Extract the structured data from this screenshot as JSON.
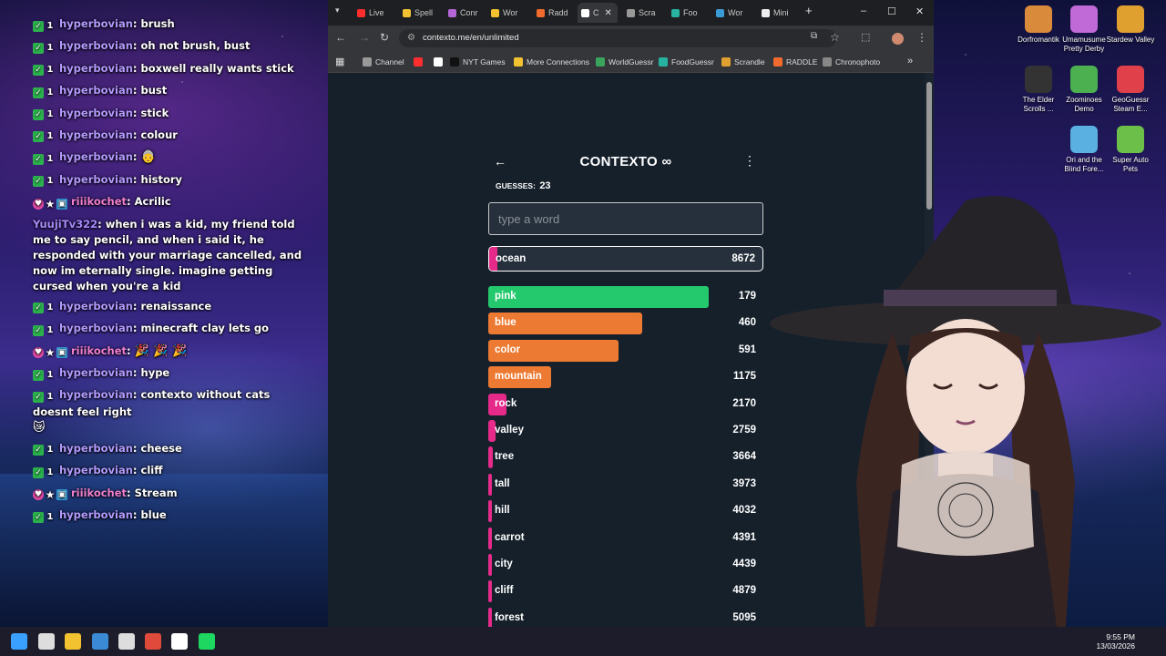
{
  "chat": [
    {
      "badges": [
        "check",
        "1"
      ],
      "user": "hyperbovian",
      "user_style": "normal",
      "text": "brush"
    },
    {
      "badges": [
        "check",
        "1"
      ],
      "user": "hyperbovian",
      "user_style": "normal",
      "text": "oh not brush, bust"
    },
    {
      "badges": [
        "check",
        "1"
      ],
      "user": "hyperbovian",
      "user_style": "normal",
      "text": "boxwell really wants stick"
    },
    {
      "badges": [
        "check",
        "1"
      ],
      "user": "hyperbovian",
      "user_style": "normal",
      "text": "bust"
    },
    {
      "badges": [
        "check",
        "1"
      ],
      "user": "hyperbovian",
      "user_style": "normal",
      "text": "stick"
    },
    {
      "badges": [
        "check",
        "1"
      ],
      "user": "hyperbovian",
      "user_style": "normal",
      "text": "colour"
    },
    {
      "badges": [
        "check",
        "1"
      ],
      "user": "hyperbovian",
      "user_style": "normal",
      "text": "",
      "emote": "👵"
    },
    {
      "badges": [
        "check",
        "1"
      ],
      "user": "hyperbovian",
      "user_style": "normal",
      "text": "history"
    },
    {
      "badges": [
        "heart",
        "star",
        "sub"
      ],
      "user": "riiikochet",
      "user_style": "pink",
      "text": "Acrilic"
    },
    {
      "badges": [],
      "user": "YuujiTv322",
      "user_style": "violet",
      "text": "when i was a kid, my friend told me to say pencil, and when i said it, he responded with your marriage cancelled, and now im eternally single. imagine getting cursed when you're a kid"
    },
    {
      "badges": [
        "check",
        "1"
      ],
      "user": "hyperbovian",
      "user_style": "normal",
      "text": "renaissance"
    },
    {
      "badges": [
        "check",
        "1"
      ],
      "user": "hyperbovian",
      "user_style": "normal",
      "text": "minecraft clay lets go"
    },
    {
      "badges": [
        "heart",
        "star",
        "sub"
      ],
      "user": "riiikochet",
      "user_style": "pink",
      "text": "",
      "emote": "🎉 🎉 🎉"
    },
    {
      "badges": [
        "check",
        "1"
      ],
      "user": "hyperbovian",
      "user_style": "normal",
      "text": "hype"
    },
    {
      "badges": [
        "check",
        "1"
      ],
      "user": "hyperbovian",
      "user_style": "normal",
      "text": "contexto without cats doesnt feel right",
      "emote": "😿"
    },
    {
      "badges": [
        "check",
        "1"
      ],
      "user": "hyperbovian",
      "user_style": "normal",
      "text": "cheese"
    },
    {
      "badges": [
        "check",
        "1"
      ],
      "user": "hyperbovian",
      "user_style": "normal",
      "text": "cliff"
    },
    {
      "badges": [
        "heart",
        "star",
        "sub"
      ],
      "user": "riiikochet",
      "user_style": "pink",
      "text": "Stream"
    },
    {
      "badges": [
        "check",
        "1"
      ],
      "user": "hyperbovian",
      "user_style": "normal",
      "text": "blue"
    }
  ],
  "browser": {
    "tabs": [
      {
        "label": "Live",
        "color": "#ff2d2d"
      },
      {
        "label": "Spell",
        "color": "#f2c230"
      },
      {
        "label": "Conr",
        "color": "#b465d6"
      },
      {
        "label": "Wor",
        "color": "#f2c230"
      },
      {
        "label": "Radd",
        "color": "#f26b2e"
      },
      {
        "label": "C",
        "color": "#ffffff",
        "active": true
      },
      {
        "label": "Scra",
        "color": "#999999"
      },
      {
        "label": "Foo",
        "color": "#27b3a0"
      },
      {
        "label": "Wor",
        "color": "#3a9bd6"
      },
      {
        "label": "Mini",
        "color": "#eeeeee"
      }
    ],
    "url": "contexto.me/en/unlimited",
    "bookmarks": [
      {
        "label": "Channel",
        "color": "#999999",
        "icon": "folder-icon"
      },
      {
        "label": "",
        "color": "#ff2d2d",
        "icon": "youtube-icon"
      },
      {
        "label": "",
        "color": "#ffffff",
        "icon": "x-icon"
      },
      {
        "label": "NYT Games",
        "color": "#111111",
        "icon": "nyt-icon"
      },
      {
        "label": "More Connections",
        "color": "#f2c230",
        "icon": "grid-icon"
      },
      {
        "label": "WorldGuessr",
        "color": "#3aa35c",
        "icon": "globe-icon"
      },
      {
        "label": "FoodGuessr",
        "color": "#27b3a0",
        "icon": "food-icon"
      },
      {
        "label": "Scrandle",
        "color": "#e0a030",
        "icon": "scrandle-icon"
      },
      {
        "label": "RADDLE",
        "color": "#f26b2e",
        "icon": "raddle-icon"
      },
      {
        "label": "Chronophoto",
        "color": "#888888",
        "icon": "camera-icon"
      }
    ]
  },
  "app": {
    "title": "CONTEXTO",
    "title_symbol": "∞",
    "guesses_label": "GUESSES:",
    "guesses_count": "23",
    "input_placeholder": "type a word",
    "last_guess": {
      "word": "ocean",
      "rank": "8672",
      "fill_fraction": 0.03,
      "color": "#e52a8a"
    },
    "guesses": [
      {
        "word": "pink",
        "rank": "179",
        "fill_fraction": 0.8,
        "color": "#24c96d"
      },
      {
        "word": "blue",
        "rank": "460",
        "fill_fraction": 0.56,
        "color": "#ed7a32"
      },
      {
        "word": "color",
        "rank": "591",
        "fill_fraction": 0.475,
        "color": "#ed7a32"
      },
      {
        "word": "mountain",
        "rank": "1175",
        "fill_fraction": 0.23,
        "color": "#ed7a32"
      },
      {
        "word": "rock",
        "rank": "2170",
        "fill_fraction": 0.065,
        "color": "#e52a8a"
      },
      {
        "word": "valley",
        "rank": "2759",
        "fill_fraction": 0.025,
        "color": "#e52a8a"
      },
      {
        "word": "tree",
        "rank": "3664",
        "fill_fraction": 0.015,
        "color": "#e52a8a"
      },
      {
        "word": "tall",
        "rank": "3973",
        "fill_fraction": 0.012,
        "color": "#e52a8a"
      },
      {
        "word": "hill",
        "rank": "4032",
        "fill_fraction": 0.012,
        "color": "#e52a8a"
      },
      {
        "word": "carrot",
        "rank": "4391",
        "fill_fraction": 0.01,
        "color": "#e52a8a"
      },
      {
        "word": "city",
        "rank": "4439",
        "fill_fraction": 0.01,
        "color": "#e52a8a"
      },
      {
        "word": "cliff",
        "rank": "4879",
        "fill_fraction": 0.01,
        "color": "#e52a8a"
      },
      {
        "word": "forest",
        "rank": "5095",
        "fill_fraction": 0.01,
        "color": "#e52a8a"
      }
    ]
  },
  "desktop_icons": [
    {
      "label": "Dorfromantik",
      "color": "#d98a3a"
    },
    {
      "label": "Umamusume Pretty Derby",
      "color": "#c06ad8"
    },
    {
      "label": "Stardew Valley",
      "color": "#e0a030"
    },
    {
      "label": "The Elder Scrolls ...",
      "color": "#333333"
    },
    {
      "label": "Zoominoes Demo",
      "color": "#4caf50"
    },
    {
      "label": "GeoGuessr Steam E...",
      "color": "#e0404a"
    },
    {
      "label": "Ori and the Blind Fore...",
      "color": "#5ab0e0"
    },
    {
      "label": "Super Auto Pets",
      "color": "#6cc04a"
    }
  ],
  "taskbar": {
    "time": "9:55 PM",
    "date": "13/03/2026",
    "apps": [
      {
        "icon": "windows-icon",
        "color": "#3aa0ff"
      },
      {
        "icon": "obs-icon",
        "color": "#dddddd"
      },
      {
        "icon": "file-explorer-icon",
        "color": "#f2c230"
      },
      {
        "icon": "photos-icon",
        "color": "#3a8ad6"
      },
      {
        "icon": "vtube-icon",
        "color": "#dddddd"
      },
      {
        "icon": "chrome-icon",
        "color": "#e04a3a"
      },
      {
        "icon": "capcut-icon",
        "color": "#ffffff"
      },
      {
        "icon": "spotify-icon",
        "color": "#1ed760"
      }
    ]
  }
}
